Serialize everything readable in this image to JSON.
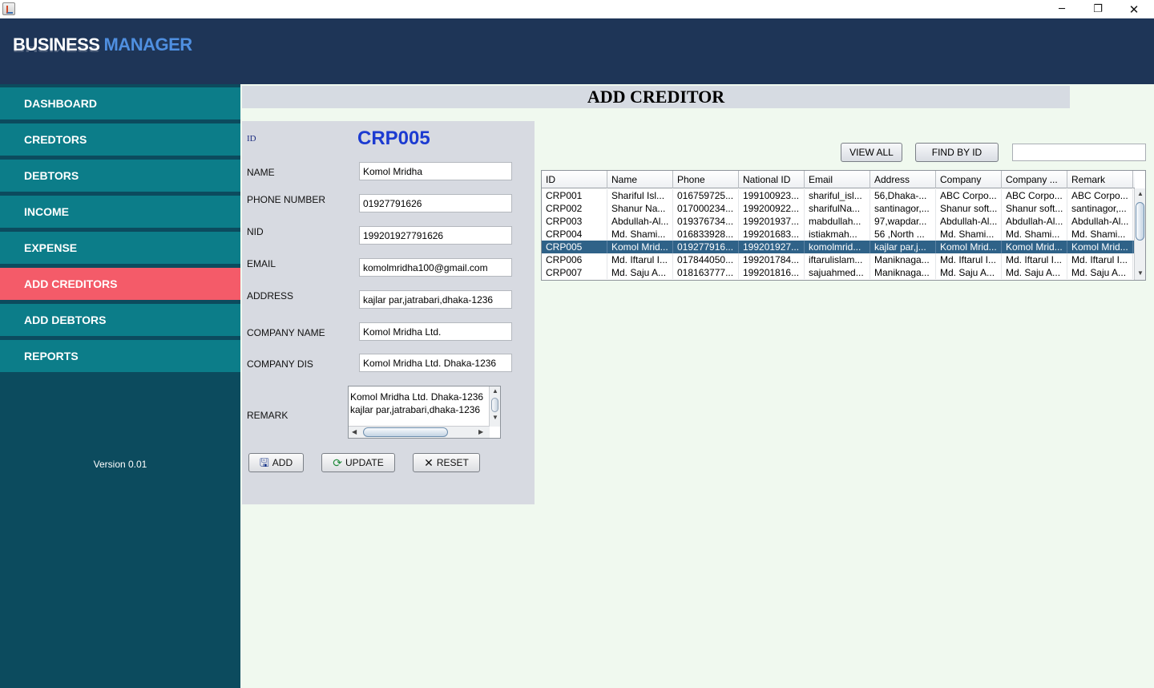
{
  "window": {
    "minimize_glyph": "─",
    "maximize_glyph": "❐",
    "close_glyph": "✕"
  },
  "header": {
    "brand_part1": "BUSINESS",
    "brand_part2": "MANAGER",
    "brand_color": "#1e3557",
    "accent_color": "#4f8fe0"
  },
  "sidebar": {
    "items": [
      {
        "label": "DASHBOARD"
      },
      {
        "label": "CREDTORS"
      },
      {
        "label": "DEBTORS"
      },
      {
        "label": "INCOME"
      },
      {
        "label": "EXPENSE"
      },
      {
        "label": "ADD CREDITORS",
        "active": true
      },
      {
        "label": "ADD DEBTORS"
      },
      {
        "label": "REPORTS"
      }
    ],
    "active_color": "#f45b69",
    "item_color": "#0c7d89",
    "version": "Version 0.01"
  },
  "page": {
    "title": "ADD CREDITOR"
  },
  "form": {
    "id_label": "ID",
    "id_value": "CRP005",
    "name_label": "NAME",
    "name_value": "Komol Mridha",
    "phone_label": "PHONE NUMBER",
    "phone_value": "01927791626",
    "nid_label": "NID",
    "nid_value": "199201927791626",
    "email_label": "EMAIL",
    "email_value": " komolmridha100@gmail.com",
    "address_label": "ADDRESS",
    "address_value": "kajlar par,jatrabari,dhaka-1236",
    "company_name_label": "COMPANY NAME",
    "company_name_value": "Komol Mridha Ltd.",
    "company_dis_label": "COMPANY DIS",
    "company_dis_value": "Komol Mridha Ltd. Dhaka-1236",
    "remark_label": "REMARK",
    "remark_line1": "Komol Mridha Ltd. Dhaka-1236",
    "remark_line2": "kajlar par,jatrabari,dhaka-1236",
    "buttons": {
      "add": "ADD",
      "update": "UPDATE",
      "reset": "RESET"
    }
  },
  "table_controls": {
    "view_all": "VIEW ALL",
    "find_by_id": "FIND BY ID",
    "search_value": ""
  },
  "table": {
    "columns": [
      "ID",
      "Name",
      "Phone",
      "National ID",
      "Email",
      "Address",
      "Company",
      "Company ...",
      "Remark"
    ],
    "rows": [
      [
        "CRP001",
        "Shariful Isl...",
        "016759725...",
        "199100923...",
        "shariful_isl...",
        "56,Dhaka-...",
        "ABC Corpo...",
        "ABC Corpo...",
        "ABC Corpo..."
      ],
      [
        "CRP002",
        "Shanur Na...",
        "017000234...",
        "199200922...",
        "sharifulNa...",
        "santinagor,...",
        "Shanur soft...",
        "Shanur soft...",
        "santinagor,..."
      ],
      [
        "CRP003",
        "Abdullah-Al...",
        "019376734...",
        "199201937...",
        "mabdullah...",
        "97,wapdar...",
        "Abdullah-Al...",
        "Abdullah-Al...",
        "Abdullah-Al..."
      ],
      [
        "CRP004",
        "Md. Shami...",
        "016833928...",
        "199201683...",
        " istiakmah...",
        "56 ,North ...",
        "Md. Shami...",
        "Md. Shami...",
        "Md. Shami..."
      ],
      [
        "CRP005",
        "Komol Mrid...",
        "019277916...",
        "199201927...",
        " komolmrid...",
        "kajlar par,j...",
        "Komol Mrid...",
        "Komol Mrid...",
        "Komol Mrid..."
      ],
      [
        "CRP006",
        "Md. Iftarul I...",
        "017844050...",
        "199201784...",
        "iftarulislam...",
        "Maniknaga...",
        "Md. Iftarul I...",
        "Md. Iftarul I...",
        "Md. Iftarul I..."
      ],
      [
        "CRP007",
        "Md. Saju A...",
        "018163777...",
        "199201816...",
        "sajuahmed...",
        "Maniknaga...",
        "Md. Saju A...",
        "Md. Saju A...",
        "Md. Saju A..."
      ]
    ],
    "selected_row": 4,
    "selected_color": "#2f6288"
  }
}
